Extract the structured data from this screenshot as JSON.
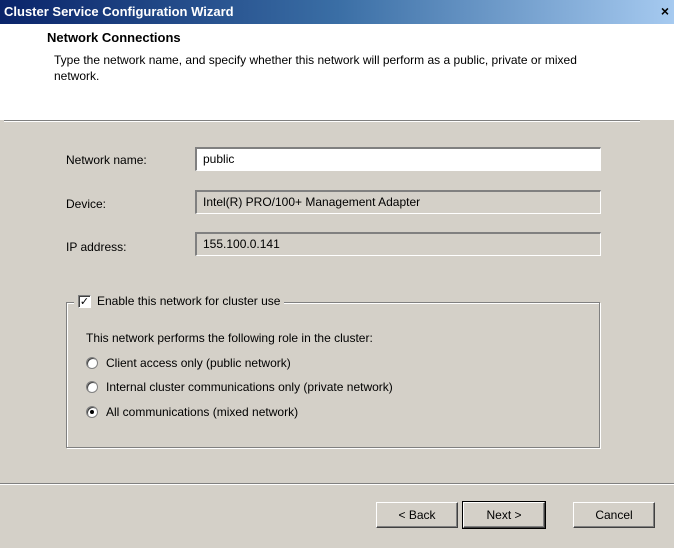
{
  "window": {
    "title": "Cluster Service Configuration Wizard",
    "close_label": "×"
  },
  "header": {
    "title": "Network Connections",
    "description": "Type the network name, and specify whether this network will perform as a public, private or mixed network."
  },
  "form": {
    "network_name_label": "Network name:",
    "network_name_value": "public",
    "device_label": "Device:",
    "device_value": "Intel(R) PRO/100+ Management Adapter",
    "ip_label": "IP address:",
    "ip_value": "155.100.0.141"
  },
  "cluster_use": {
    "checkbox_label": "Enable this network for cluster use",
    "checked": true,
    "check_glyph": "✓",
    "role_prompt": "This network performs the following role in the cluster:",
    "roles": [
      {
        "label": "Client access only (public network)",
        "selected": false
      },
      {
        "label": "Internal cluster communications only (private network)",
        "selected": false
      },
      {
        "label": "All communications (mixed network)",
        "selected": true
      }
    ]
  },
  "buttons": {
    "back": "< Back",
    "next": "Next >",
    "cancel": "Cancel"
  }
}
